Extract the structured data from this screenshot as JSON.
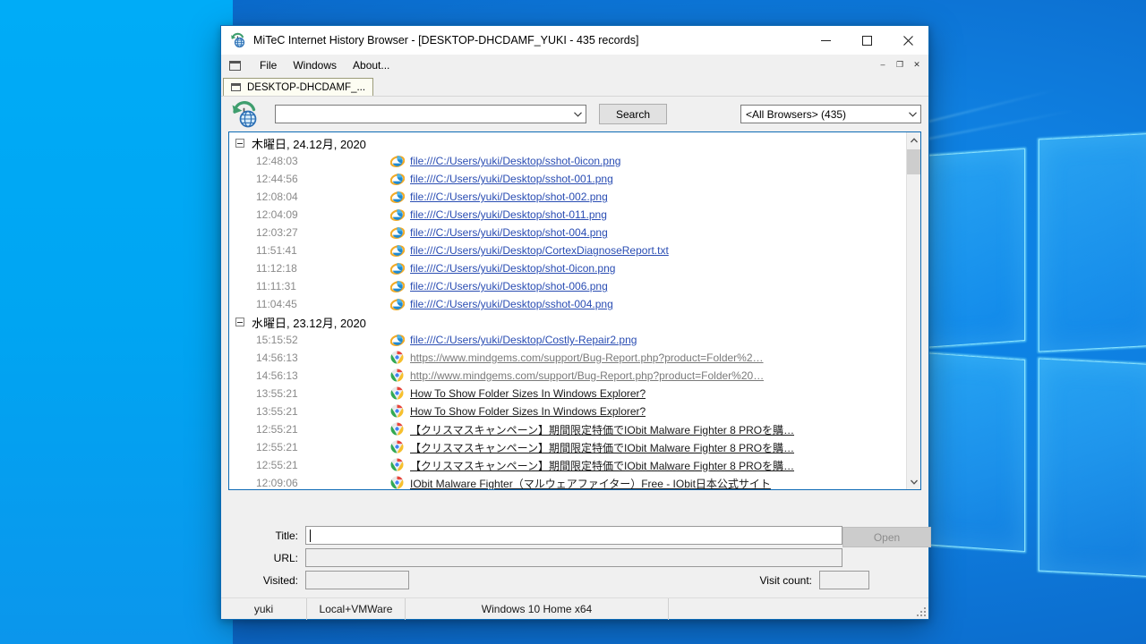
{
  "window": {
    "title": "MiTeC Internet History Browser - [DESKTOP-DHCDAMF_YUKI - 435 records]",
    "icon": "history-globe-icon",
    "minimize": "—",
    "maximize": "☐",
    "close": "✕"
  },
  "menu": {
    "mdi_icon": "mdi-window-icon",
    "items": [
      {
        "label": "File"
      },
      {
        "label": "Windows"
      },
      {
        "label": "About..."
      }
    ],
    "mdi_buttons": [
      {
        "name": "mdi-minimize",
        "glyph": "–"
      },
      {
        "name": "mdi-restore",
        "glyph": "❐"
      },
      {
        "name": "mdi-close",
        "glyph": "✕"
      }
    ]
  },
  "tabs": [
    {
      "label": "DESKTOP-DHCDAMF_...",
      "active": true
    }
  ],
  "toolbar": {
    "history_icon": "history-globe-icon",
    "search_value": "",
    "search_placeholder": "",
    "search_button": "Search",
    "browser_filter": "<All Browsers> (435)"
  },
  "list": {
    "groups": [
      {
        "date": "木曜日, 24.12月, 2020",
        "rows": [
          {
            "time": "12:48:03",
            "icon": "internet-explorer-icon",
            "text": "file:///C:/Users/yuki/Desktop/sshot-0icon.png",
            "style": "blue"
          },
          {
            "time": "12:44:56",
            "icon": "internet-explorer-icon",
            "text": "file:///C:/Users/yuki/Desktop/sshot-001.png",
            "style": "blue"
          },
          {
            "time": "12:08:04",
            "icon": "internet-explorer-icon",
            "text": "file:///C:/Users/yuki/Desktop/shot-002.png",
            "style": "blue"
          },
          {
            "time": "12:04:09",
            "icon": "internet-explorer-icon",
            "text": "file:///C:/Users/yuki/Desktop/shot-011.png",
            "style": "blue"
          },
          {
            "time": "12:03:27",
            "icon": "internet-explorer-icon",
            "text": "file:///C:/Users/yuki/Desktop/shot-004.png",
            "style": "blue"
          },
          {
            "time": "11:51:41",
            "icon": "internet-explorer-icon",
            "text": "file:///C:/Users/yuki/Desktop/CortexDiagnoseReport.txt",
            "style": "blue"
          },
          {
            "time": "11:12:18",
            "icon": "internet-explorer-icon",
            "text": "file:///C:/Users/yuki/Desktop/shot-0icon.png",
            "style": "blue"
          },
          {
            "time": "11:11:31",
            "icon": "internet-explorer-icon",
            "text": "file:///C:/Users/yuki/Desktop/shot-006.png",
            "style": "blue"
          },
          {
            "time": "11:04:45",
            "icon": "internet-explorer-icon",
            "text": "file:///C:/Users/yuki/Desktop/sshot-004.png",
            "style": "blue"
          }
        ]
      },
      {
        "date": "水曜日, 23.12月, 2020",
        "rows": [
          {
            "time": "15:15:52",
            "icon": "internet-explorer-icon",
            "text": "file:///C:/Users/yuki/Desktop/Costly-Repair2.png",
            "style": "blue"
          },
          {
            "time": "14:56:13",
            "icon": "chrome-icon",
            "text": "https://www.mindgems.com/support/Bug-Report.php?product=Folder%2…",
            "style": "gray"
          },
          {
            "time": "14:56:13",
            "icon": "chrome-icon",
            "text": "http://www.mindgems.com/support/Bug-Report.php?product=Folder%20…",
            "style": "gray"
          },
          {
            "time": "13:55:21",
            "icon": "chrome-icon",
            "text": "How To Show Folder Sizes In Windows Explorer?",
            "style": "black"
          },
          {
            "time": "13:55:21",
            "icon": "chrome-icon",
            "text": "How To Show Folder Sizes In Windows Explorer?",
            "style": "black"
          },
          {
            "time": "12:55:21",
            "icon": "chrome-icon",
            "text": "【クリスマスキャンペーン】期間限定特価でIObit Malware Fighter 8 PROを購…",
            "style": "black"
          },
          {
            "time": "12:55:21",
            "icon": "chrome-icon",
            "text": "【クリスマスキャンペーン】期間限定特価でIObit Malware Fighter 8 PROを購…",
            "style": "black"
          },
          {
            "time": "12:55:21",
            "icon": "chrome-icon",
            "text": "【クリスマスキャンペーン】期間限定特価でIObit Malware Fighter 8 PROを購…",
            "style": "black"
          },
          {
            "time": "12:09:06",
            "icon": "chrome-icon",
            "text": "IObit Malware Fighter（マルウェアファイター）Free - IObit日本公式サイト",
            "style": "black"
          }
        ]
      }
    ]
  },
  "details": {
    "title_label": "Title:",
    "title_value": "",
    "url_label": "URL:",
    "url_value": "",
    "visited_label": "Visited:",
    "visited_value": "",
    "visit_count_label": "Visit count:",
    "visit_count_value": "",
    "open_button": "Open"
  },
  "statusbar": {
    "user": "yuki",
    "source": "Local+VMWare",
    "os": "Windows 10 Home x64",
    "extra": ""
  },
  "colors": {
    "accent": "#0d6ab5",
    "link_blue": "#2a4db3",
    "link_gray": "#7a7a7a",
    "window_bg": "#f0f0f0"
  }
}
